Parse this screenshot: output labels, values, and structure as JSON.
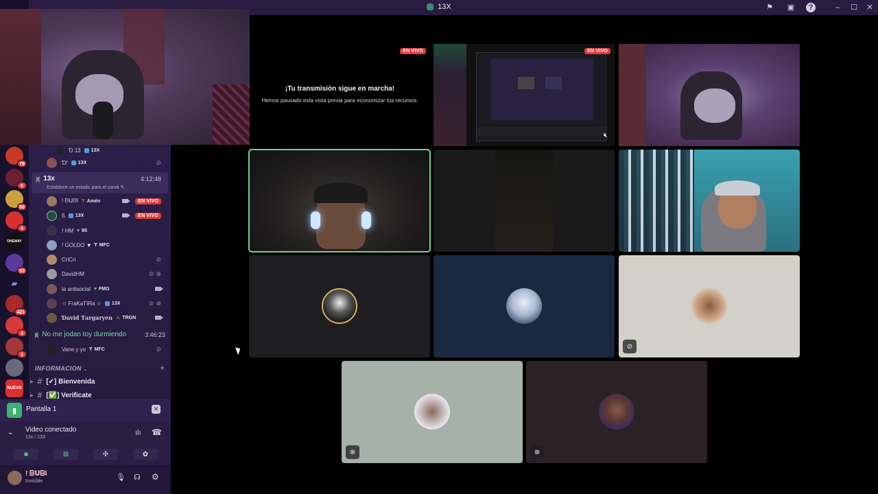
{
  "window": {
    "title": "13X"
  },
  "guilds": [
    {
      "badge": "78"
    },
    {
      "badge": "6"
    },
    {
      "badge": "86"
    },
    {
      "badge": "4"
    },
    {
      "label": "ONEWAY"
    },
    {
      "badge": "53"
    },
    {
      "badge": ""
    },
    {
      "badge": "421"
    },
    {
      "badge": "4"
    },
    {
      "badge": "3"
    },
    {
      "label": "NUEVO"
    }
  ],
  "sidebar": {
    "members_top": [
      {
        "name": "Ɗ 13",
        "tag": "13X"
      },
      {
        "name": "Ɗ!",
        "tag": "13X"
      }
    ],
    "voice_channel": {
      "name": "13x",
      "time": "4:12:48",
      "status_hint": "Establece un estado para el canal"
    },
    "members": [
      {
        "name": "! ᗷᑌᗷI",
        "tag": "Amén",
        "live": "EN VIVO"
      },
      {
        "name": "ß",
        "tag": "13X",
        "live": "EN VIVO"
      },
      {
        "name": "! HM",
        "tag": "95"
      },
      {
        "name": "! GOLDO",
        "tag": "MFC"
      },
      {
        "name": "CriCri"
      },
      {
        "name": "DavidHM"
      },
      {
        "name": "la antisocial",
        "tag": "FMG"
      },
      {
        "name": "☆ FraKaTIRa ☆",
        "tag": "13X"
      },
      {
        "name": "Ɗavid Ƭargaryen",
        "tag": "TRGN"
      }
    ],
    "voice_channel_2": {
      "name": "No me jodan toy durmiendo",
      "time": "3:46:23"
    },
    "members_2": [
      {
        "name": "Vane y yo",
        "tag": "MFC"
      }
    ],
    "category": "INFORMACION",
    "text_channels": [
      {
        "name": "[✔] Bienvenida"
      },
      {
        "name": "[✅] Verificate"
      }
    ]
  },
  "stream_panel": {
    "label": "Pantalla 1"
  },
  "voice_panel": {
    "status": "Video conectado",
    "server": "13x / 13X"
  },
  "user_panel": {
    "name": "! ᗷᑌᗷI",
    "status": "Invisible"
  },
  "preview": {
    "title": "¡Tu transmisión sigue en marcha!",
    "subtitle": "Hemos pausado esta vista previa para economizar tus recursos.",
    "live_label": "EN VIVO"
  },
  "colors": {
    "accent_green": "#6ed394",
    "live_red": "#e23a3a",
    "sidebar_bg": "#2b1f4a",
    "titlebar_bg": "#2a1b40"
  }
}
